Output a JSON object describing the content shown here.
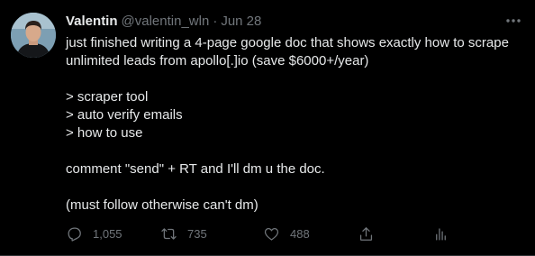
{
  "author": {
    "name": "Valentin",
    "handle": "@valentin_wln",
    "separator": "·",
    "date": "Jun 28"
  },
  "tweet": {
    "lines": [
      "just finished writing a 4-page google doc that shows exactly how to scrape",
      "unlimited leads from apollo[.]io (save $6000+/year)",
      "> scraper tool",
      "> auto verify emails",
      "> how to use",
      "comment \"send\" + RT and I'll dm u the doc.",
      "(must follow otherwise can't dm)"
    ]
  },
  "actions": {
    "reply_count": "1,055",
    "retweet_count": "735",
    "like_count": "488"
  },
  "icons": {
    "more": "more-icon",
    "reply": "reply-icon",
    "retweet": "retweet-icon",
    "like": "heart-icon",
    "share": "share-icon",
    "analytics": "analytics-icon"
  }
}
